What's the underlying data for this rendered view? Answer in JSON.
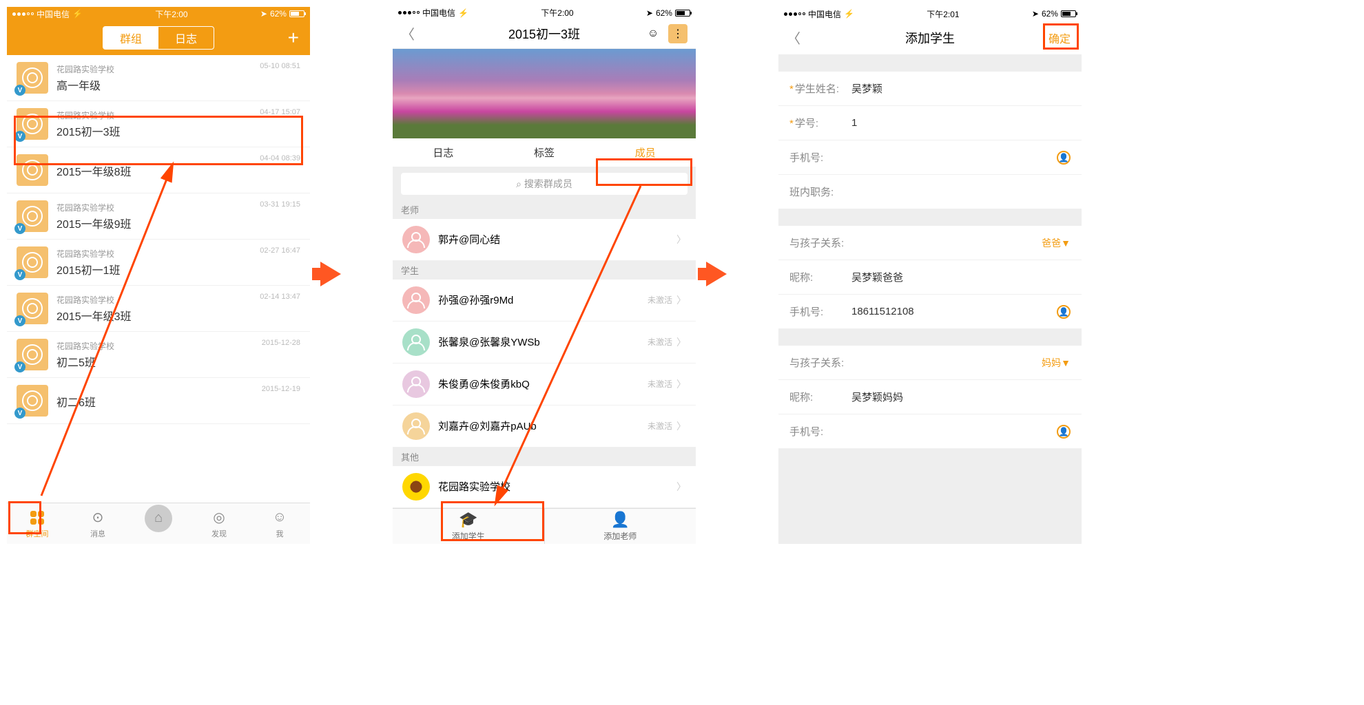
{
  "status": {
    "carrier": "中国电信",
    "time1": "下午2:00",
    "time2": "下午2:01",
    "battery": "62%"
  },
  "screen1": {
    "seg": {
      "groups": "群组",
      "logs": "日志"
    },
    "items": [
      {
        "school": "花园路实验学校",
        "name": "高一年级",
        "time": "05-10 08:51",
        "v": true
      },
      {
        "school": "花园路实验学校",
        "name": "2015初一3班",
        "time": "04-17 15:07",
        "v": true
      },
      {
        "school": "",
        "name": "2015一年级8班",
        "time": "04-04 08:39",
        "v": false
      },
      {
        "school": "花园路实验学校",
        "name": "2015一年级9班",
        "time": "03-31 19:15",
        "v": true
      },
      {
        "school": "花园路实验学校",
        "name": "2015初一1班",
        "time": "02-27 16:47",
        "v": true
      },
      {
        "school": "花园路实验学校",
        "name": "2015一年级3班",
        "time": "02-14 13:47",
        "v": true
      },
      {
        "school": "花园路实验学校",
        "name": "初二5班",
        "time": "2015-12-28",
        "v": true
      },
      {
        "school": "",
        "name": "初二6班",
        "time": "2015-12-19",
        "v": true
      }
    ],
    "nav": {
      "space": "群空间",
      "msg": "消息",
      "discover": "发现",
      "me": "我"
    }
  },
  "screen2": {
    "title": "2015初一3班",
    "tabs": {
      "log": "日志",
      "tag": "标签",
      "member": "成员"
    },
    "search": "搜索群成员",
    "sec_teacher": "老师",
    "sec_student": "学生",
    "sec_other": "其他",
    "teachers": [
      {
        "name": "郭卉@同心结"
      }
    ],
    "students": [
      {
        "name": "孙强@孙强r9Md",
        "status": "未激活",
        "color": "#f5b8b8"
      },
      {
        "name": "张馨泉@张馨泉YWSb",
        "status": "未激活",
        "color": "#a8e0c8"
      },
      {
        "name": "朱俊勇@朱俊勇kbQ",
        "status": "未激活",
        "color": "#e8c8e0"
      },
      {
        "name": "刘嘉卉@刘嘉卉pAUb",
        "status": "未激活",
        "color": "#f5d49a"
      }
    ],
    "others": [
      {
        "name": "花园路实验学校"
      }
    ],
    "nav": {
      "add_student": "添加学生",
      "add_teacher": "添加老师"
    }
  },
  "screen3": {
    "title": "添加学生",
    "confirm": "确定",
    "fields": {
      "name_label": "学生姓名:",
      "name_val": "吴梦颖",
      "id_label": "学号:",
      "id_val": "1",
      "phone_label": "手机号:",
      "duty_label": "班内职务:",
      "rel_label": "与孩子关系:",
      "rel_dad": "爸爸",
      "rel_mom": "妈妈",
      "nick_label": "昵称:",
      "nick_dad": "吴梦颖爸爸",
      "nick_mom": "吴梦颖妈妈",
      "phone2_label": "手机号:",
      "phone_dad": "18611512108"
    }
  }
}
